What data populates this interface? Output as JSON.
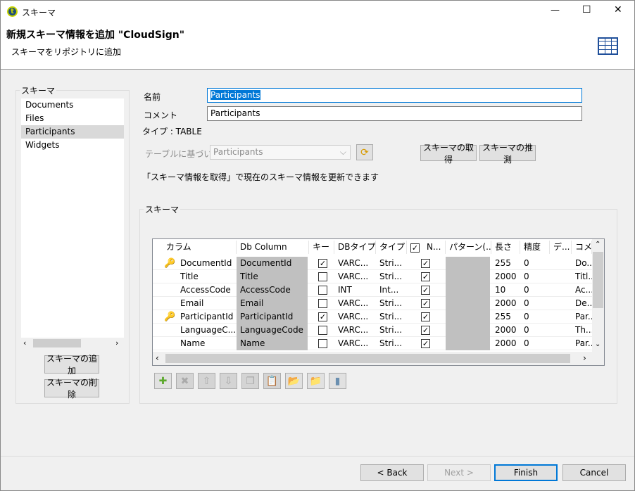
{
  "window": {
    "title": "スキーマ",
    "minimize": "—",
    "maximize": "☐",
    "close": "✕"
  },
  "header": {
    "title": "新規スキーマ情報を追加 \"CloudSign\"",
    "subtitle": "スキーマをリポジトリに追加"
  },
  "sidebar": {
    "group_label": "スキーマ",
    "items": [
      "Documents",
      "Files",
      "Participants",
      "Widgets"
    ],
    "selected": "Participants",
    "add_button": "スキーマの追加",
    "delete_button": "スキーマの削除"
  },
  "form": {
    "name_label": "名前",
    "name_value": "Participants",
    "comment_label": "コメント",
    "comment_value": "Participants",
    "type_text": "タイプ : TABLE",
    "based_label": "テーブルに基づいた",
    "based_value": "Participants",
    "get_schema_button": "スキーマの取得",
    "guess_schema_button": "スキーマの推測",
    "info_text": "「スキーマ情報を取得」で現在のスキーマ情報を更新できます"
  },
  "schema": {
    "group_label": "スキーマ",
    "columns": [
      "カラム",
      "Db Column",
      "キー",
      "DBタイプ",
      "タイプ",
      "N...",
      "パターン(...",
      "長さ",
      "精度",
      "デ...",
      "コメ..."
    ],
    "rows": [
      {
        "key": true,
        "column": "DocumentId",
        "db": "DocumentId",
        "dbtype": "VARC...",
        "type": "Stri...",
        "nullable": true,
        "length": "255",
        "precision": "0",
        "comment": "Do..."
      },
      {
        "key": false,
        "column": "Title",
        "db": "Title",
        "dbtype": "VARC...",
        "type": "Stri...",
        "nullable": true,
        "length": "2000",
        "precision": "0",
        "comment": "Titl..."
      },
      {
        "key": false,
        "column": "AccessCode",
        "db": "AccessCode",
        "dbtype": "INT",
        "type": "Int...",
        "nullable": true,
        "length": "10",
        "precision": "0",
        "comment": "Ac..."
      },
      {
        "key": false,
        "column": "Email",
        "db": "Email",
        "dbtype": "VARC...",
        "type": "Stri...",
        "nullable": true,
        "length": "2000",
        "precision": "0",
        "comment": "De..."
      },
      {
        "key": true,
        "column": "ParticipantId",
        "db": "ParticipantId",
        "dbtype": "VARC...",
        "type": "Stri...",
        "nullable": true,
        "length": "255",
        "precision": "0",
        "comment": "Par..."
      },
      {
        "key": false,
        "column": "LanguageC...",
        "db": "LanguageCode",
        "dbtype": "VARC...",
        "type": "Stri...",
        "nullable": true,
        "length": "2000",
        "precision": "0",
        "comment": "Th..."
      },
      {
        "key": false,
        "column": "Name",
        "db": "Name",
        "dbtype": "VARC...",
        "type": "Stri...",
        "nullable": true,
        "length": "2000",
        "precision": "0",
        "comment": "Par..."
      }
    ]
  },
  "footer": {
    "back": "< Back",
    "next": "Next >",
    "finish": "Finish",
    "cancel": "Cancel"
  }
}
